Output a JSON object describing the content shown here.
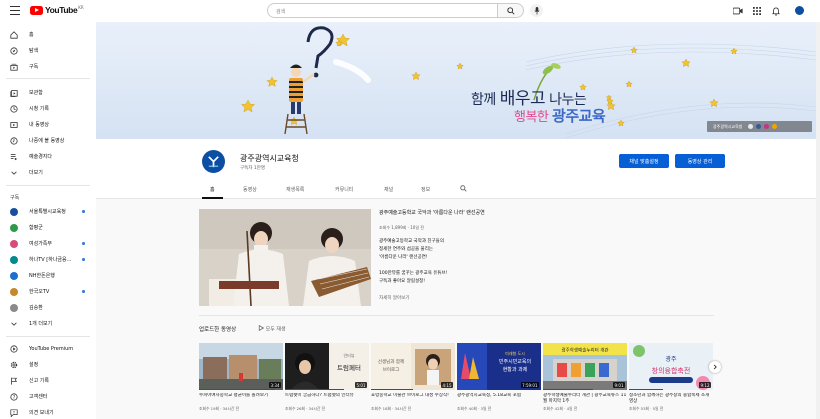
{
  "topbar": {
    "logo_text": "YouTube",
    "logo_region": "KR",
    "search_placeholder": "검색"
  },
  "sidebar": {
    "main": [
      {
        "label": "홈",
        "icon": "home-icon"
      },
      {
        "label": "탐색",
        "icon": "explore-icon"
      },
      {
        "label": "구독",
        "icon": "subscriptions-icon"
      }
    ],
    "library": [
      {
        "label": "보관함",
        "icon": "library-icon"
      },
      {
        "label": "시청 기록",
        "icon": "history-icon"
      },
      {
        "label": "내 동영상",
        "icon": "my-videos-icon"
      },
      {
        "label": "나중에 볼 동영상",
        "icon": "watch-later-icon"
      },
      {
        "label": "예술경지다",
        "icon": "playlist-icon"
      },
      {
        "label": "더보기",
        "icon": "chevron-down-icon"
      }
    ],
    "subs_heading": "구독",
    "subs": [
      {
        "label": "서울특별시교육청",
        "color": "#1a4fa0",
        "dot": true
      },
      {
        "label": "함평군",
        "color": "#2e9b48",
        "dot": false
      },
      {
        "label": "여성가족부",
        "color": "#d94b7a",
        "dot": true
      },
      {
        "label": "하나TV [하나금융...",
        "color": "#008c8c",
        "dot": true
      },
      {
        "label": "NH한돈은행",
        "color": "#1c6fd1",
        "dot": false
      },
      {
        "label": "한국오TV",
        "color": "#c9872b",
        "dot": true
      },
      {
        "label": "김승환",
        "color": "#8a8a8a",
        "dot": false
      },
      {
        "label": "1개 더보기",
        "color": "",
        "dot": false
      }
    ],
    "more": [
      {
        "label": "YouTube Premium",
        "icon": "youtube-premium-icon"
      },
      {
        "label": "설정",
        "icon": "gear-icon"
      },
      {
        "label": "신고 기록",
        "icon": "flag-icon"
      },
      {
        "label": "고객센터",
        "icon": "help-icon"
      },
      {
        "label": "의견 보내기",
        "icon": "feedback-icon"
      }
    ]
  },
  "banner": {
    "line1_a": "함께 ",
    "line1_b": "배우고",
    "line1_c": " 나누는",
    "line2_a": "행복한 ",
    "line2_b": "광주교육",
    "link_text": "광주광역시교육청",
    "sky_color": "#dfe9f6"
  },
  "channel": {
    "name": "광주광역시교육청",
    "subscribers": "구독자 1만명",
    "customize_label": "채널 맞춤설정",
    "manage_label": "동영상 관리"
  },
  "tabs": [
    "홈",
    "동영상",
    "재생목록",
    "커뮤니티",
    "채널",
    "정보"
  ],
  "featured": {
    "title": "광주예술고등학교 국악과 '아름다운 나라' 랜선공연",
    "meta": "조회수 1,899회 · 10일 전",
    "desc": [
      "광주예술고등학교 국악과 친구들의",
      "정세한 연주와 섬공을 울리는",
      "'아름다운 나라' 랜선공연!",
      "",
      "100만뷰를 꿈꾸는 광주교육 유튜브!",
      "구독과 좋아요 알림설정!"
    ],
    "more": "자세히 알아보기"
  },
  "uploads": {
    "title": "업로드한 동영상",
    "play_all": "모두 재생",
    "videos": [
      {
        "title": "수피아여자중학교 평균이를 돌려보기",
        "meta": "조회수 19회 · 34시간 전",
        "duration": "3:34",
        "progress": 0.9
      },
      {
        "title": "트럼펫이 궁금하다? 트럼펫의 인터뷰",
        "meta": "조회수 26회 · 34시간 전",
        "duration": "5:01",
        "progress": 0.7
      },
      {
        "title": "효령중학교 미술관 브이로그 대성 수상작!",
        "meta": "조회수 18회 · 34시간 전",
        "duration": "4:15",
        "progress": 0.5
      },
      {
        "title": "광주광역시교육청, 5.18교육 포럼",
        "meta": "조회수 40회 · 3일 전",
        "duration": "7:59:01",
        "progress": 0.3
      },
      {
        "title": "광주학생예술누리터 개관 | 광주교육뉴스 11월 마지막 1주",
        "meta": "조회수 42회 · 4일 전",
        "duration": "9:01",
        "progress": 0.6
      },
      {
        "title": "청소년과 함께하는 광주창의 융합축제 소개 영상",
        "meta": "조회수 53회 · 5일 전",
        "duration": "9:12",
        "progress": 0.4
      }
    ]
  }
}
